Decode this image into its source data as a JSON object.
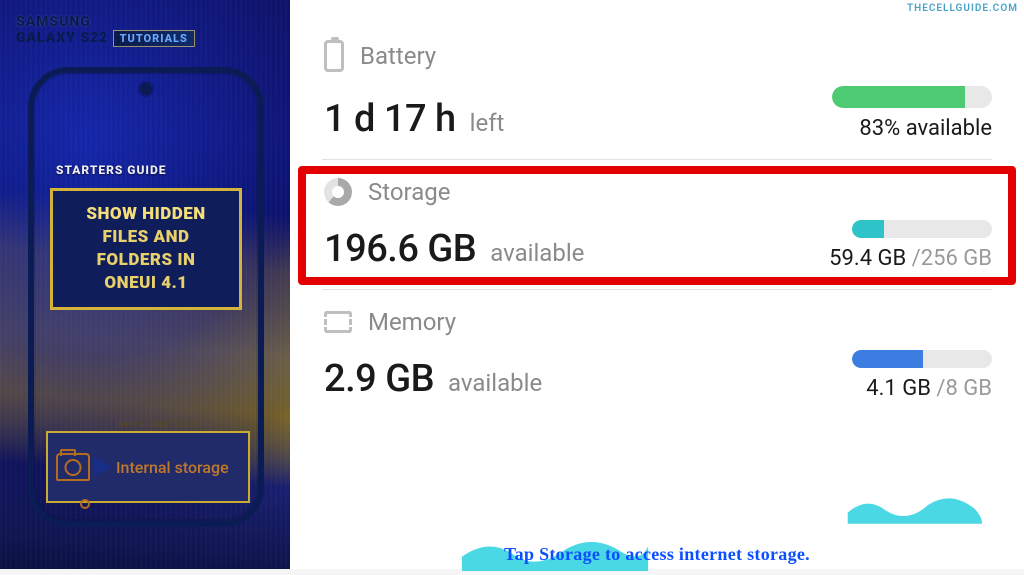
{
  "watermark": "THECELLGUIDE.COM",
  "sidebar": {
    "brand1": "SAMSUNG",
    "brand2": "GALAXY S22",
    "brand_tag": "TUTORIALS",
    "starters": "STARTERS GUIDE",
    "title_line1": "SHOW HIDDEN",
    "title_line2": "FILES AND",
    "title_line3": "FOLDERS IN",
    "title_line4": "ONEUI 4.1",
    "internal_top": "new hidden folder",
    "internal_label": "Internal storage"
  },
  "battery": {
    "label": "Battery",
    "value": "1 d 17 h",
    "suffix": "left",
    "right": "83% available",
    "fill_pct": 83,
    "fill_color": "#4fca74"
  },
  "storage": {
    "label": "Storage",
    "value": "196.6 GB",
    "suffix": "available",
    "right_primary": "59.4 GB ",
    "right_secondary": "/256 GB",
    "fill_pct": 23,
    "fill_color": "#2ec3c8"
  },
  "memory": {
    "label": "Memory",
    "value": "2.9 GB",
    "suffix": "available",
    "right_primary": "4.1 GB ",
    "right_secondary": "/8 GB",
    "fill_pct": 51,
    "fill_color": "#3b7de0"
  },
  "caption": "Tap Storage to access internet storage."
}
